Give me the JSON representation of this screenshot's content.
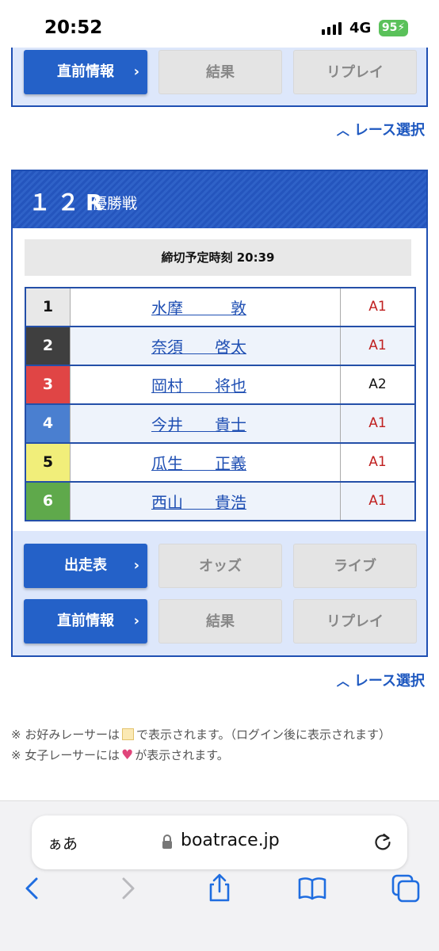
{
  "status_bar": {
    "time": "20:52",
    "network": "4G",
    "battery": "95"
  },
  "top_card": {
    "buttons": [
      {
        "label": "直前情報",
        "state": "active"
      },
      {
        "label": "結果",
        "state": "disabled"
      },
      {
        "label": "リプレイ",
        "state": "disabled"
      }
    ]
  },
  "race_select_label": "レース選択",
  "race": {
    "number": "１２R",
    "name": "優勝戦",
    "deadline": "締切予定時刻 20:39",
    "racers": [
      {
        "boat": "1",
        "name": "水摩　　　敦",
        "class": "A1",
        "color": "#e8e8e8",
        "text_color": "#111111"
      },
      {
        "boat": "2",
        "name": "奈須　　啓太",
        "class": "A1",
        "color": "#3f3f3f",
        "text_color": "#ffffff"
      },
      {
        "boat": "3",
        "name": "岡村　　将也",
        "class": "A2",
        "color": "#e04545",
        "text_color": "#ffffff"
      },
      {
        "boat": "4",
        "name": "今井　　貴士",
        "class": "A1",
        "color": "#4a7fd0",
        "text_color": "#ffffff"
      },
      {
        "boat": "5",
        "name": "瓜生　　正義",
        "class": "A1",
        "color": "#f1ee7a",
        "text_color": "#111111"
      },
      {
        "boat": "6",
        "name": "西山　　貴浩",
        "class": "A1",
        "color": "#5fa94b",
        "text_color": "#ffffff"
      }
    ],
    "buttons_row1": [
      {
        "label": "出走表",
        "state": "active"
      },
      {
        "label": "オッズ",
        "state": "disabled"
      },
      {
        "label": "ライブ",
        "state": "disabled"
      }
    ],
    "buttons_row2": [
      {
        "label": "直前情報",
        "state": "active"
      },
      {
        "label": "結果",
        "state": "disabled"
      },
      {
        "label": "リプレイ",
        "state": "disabled"
      }
    ]
  },
  "notes": {
    "note1_prefix": "※ お好みレーサーは",
    "note1_suffix": "で表示されます。（ログイン後に表示されます）",
    "note2_prefix": "※ 女子レーサーには",
    "note2_suffix": "が表示されます。"
  },
  "browser": {
    "aa_label": "ぁあ",
    "url": "boatrace.jp"
  },
  "colors": {
    "accent": "#2461c8",
    "header_blue": "#2455bd",
    "class_a1": "#c02020"
  }
}
